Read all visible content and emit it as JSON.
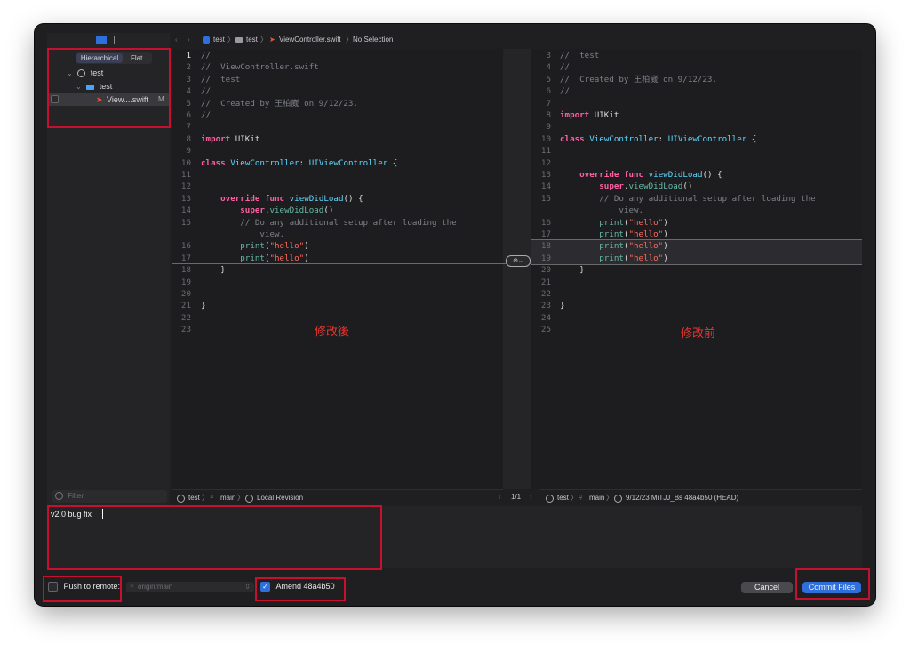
{
  "sidebar": {
    "segments": [
      "Hierarchical",
      "Flat"
    ],
    "tree": [
      {
        "label": "test",
        "icon": "clock-icon"
      },
      {
        "label": "test",
        "icon": "folder-icon"
      },
      {
        "label": "View....swift",
        "icon": "swift-icon",
        "badge": "M"
      }
    ],
    "filter_placeholder": "Filter"
  },
  "breadcrumb": {
    "project": "test",
    "folder": "test",
    "file": "ViewController.swift",
    "selection": "No Selection"
  },
  "left_pane": {
    "annotation": "修改後",
    "lines": [
      {
        "n": "1",
        "t": [
          [
            "c-com",
            "//"
          ]
        ]
      },
      {
        "n": "2",
        "t": [
          [
            "c-com",
            "//  ViewController.swift"
          ]
        ]
      },
      {
        "n": "3",
        "t": [
          [
            "c-com",
            "//  test"
          ]
        ]
      },
      {
        "n": "4",
        "t": [
          [
            "c-com",
            "//"
          ]
        ]
      },
      {
        "n": "5",
        "t": [
          [
            "c-com",
            "//  Created by 王柏崴 on 9/12/23."
          ]
        ]
      },
      {
        "n": "6",
        "t": [
          [
            "c-com",
            "//"
          ]
        ]
      },
      {
        "n": "7",
        "t": []
      },
      {
        "n": "8",
        "t": [
          [
            "c-kw",
            "import"
          ],
          [
            "c-pl",
            " UIKit"
          ]
        ]
      },
      {
        "n": "9",
        "t": []
      },
      {
        "n": "10",
        "t": [
          [
            "c-kw",
            "class"
          ],
          [
            "c-pl",
            " "
          ],
          [
            "c-ty",
            "ViewController"
          ],
          [
            "c-pl",
            ": "
          ],
          [
            "c-ty",
            "UIViewController"
          ],
          [
            "c-pl",
            " {"
          ]
        ]
      },
      {
        "n": "11",
        "t": []
      },
      {
        "n": "12",
        "t": []
      },
      {
        "n": "13",
        "t": [
          [
            "c-pl",
            "    "
          ],
          [
            "c-kw",
            "override"
          ],
          [
            "c-pl",
            " "
          ],
          [
            "c-kw",
            "func"
          ],
          [
            "c-pl",
            " "
          ],
          [
            "c-ty",
            "viewDidLoad"
          ],
          [
            "c-pl",
            "() {"
          ]
        ]
      },
      {
        "n": "14",
        "t": [
          [
            "c-pl",
            "        "
          ],
          [
            "c-kw",
            "super"
          ],
          [
            "c-pl",
            "."
          ],
          [
            "c-fn",
            "viewDidLoad"
          ],
          [
            "c-pl",
            "()"
          ]
        ]
      },
      {
        "n": "15",
        "t": [
          [
            "c-pl",
            "        "
          ],
          [
            "c-com",
            "// Do any additional setup after loading the"
          ]
        ]
      },
      {
        "n": "",
        "t": [
          [
            "c-pl",
            "            "
          ],
          [
            "c-com",
            "view."
          ]
        ]
      },
      {
        "n": "16",
        "t": [
          [
            "c-pl",
            "        "
          ],
          [
            "c-fn",
            "print"
          ],
          [
            "c-pl",
            "("
          ],
          [
            "c-str",
            "\"hello\""
          ],
          [
            "c-pl",
            ")"
          ]
        ]
      },
      {
        "n": "17",
        "t": [
          [
            "c-pl",
            "        "
          ],
          [
            "c-fn",
            "print"
          ],
          [
            "c-pl",
            "("
          ],
          [
            "c-str",
            "\"hello\""
          ],
          [
            "c-pl",
            ")"
          ]
        ]
      },
      {
        "n": "18",
        "t": [
          [
            "c-pl",
            "    }"
          ]
        ]
      },
      {
        "n": "19",
        "t": []
      },
      {
        "n": "20",
        "t": []
      },
      {
        "n": "21",
        "t": [
          [
            "c-pl",
            "}"
          ]
        ]
      },
      {
        "n": "22",
        "t": []
      },
      {
        "n": "23",
        "t": []
      }
    ]
  },
  "right_pane": {
    "annotation": "修改前",
    "lines": [
      {
        "n": "3",
        "t": [
          [
            "c-com",
            "//  test"
          ]
        ]
      },
      {
        "n": "4",
        "t": [
          [
            "c-com",
            "//"
          ]
        ]
      },
      {
        "n": "5",
        "t": [
          [
            "c-com",
            "//  Created by 王柏崴 on 9/12/23."
          ]
        ]
      },
      {
        "n": "6",
        "t": [
          [
            "c-com",
            "//"
          ]
        ]
      },
      {
        "n": "7",
        "t": []
      },
      {
        "n": "8",
        "t": [
          [
            "c-kw",
            "import"
          ],
          [
            "c-pl",
            " UIKit"
          ]
        ]
      },
      {
        "n": "9",
        "t": []
      },
      {
        "n": "10",
        "t": [
          [
            "c-kw",
            "class"
          ],
          [
            "c-pl",
            " "
          ],
          [
            "c-ty",
            "ViewController"
          ],
          [
            "c-pl",
            ": "
          ],
          [
            "c-ty",
            "UIViewController"
          ],
          [
            "c-pl",
            " {"
          ]
        ]
      },
      {
        "n": "11",
        "t": []
      },
      {
        "n": "12",
        "t": []
      },
      {
        "n": "13",
        "t": [
          [
            "c-pl",
            "    "
          ],
          [
            "c-kw",
            "override"
          ],
          [
            "c-pl",
            " "
          ],
          [
            "c-kw",
            "func"
          ],
          [
            "c-pl",
            " "
          ],
          [
            "c-ty",
            "viewDidLoad"
          ],
          [
            "c-pl",
            "() {"
          ]
        ]
      },
      {
        "n": "14",
        "t": [
          [
            "c-pl",
            "        "
          ],
          [
            "c-kw",
            "super"
          ],
          [
            "c-pl",
            "."
          ],
          [
            "c-fn",
            "viewDidLoad"
          ],
          [
            "c-pl",
            "()"
          ]
        ]
      },
      {
        "n": "15",
        "t": [
          [
            "c-pl",
            "        "
          ],
          [
            "c-com",
            "// Do any additional setup after loading the"
          ]
        ]
      },
      {
        "n": "",
        "t": [
          [
            "c-pl",
            "            "
          ],
          [
            "c-com",
            "view."
          ]
        ]
      },
      {
        "n": "16",
        "t": [
          [
            "c-pl",
            "        "
          ],
          [
            "c-fn",
            "print"
          ],
          [
            "c-pl",
            "("
          ],
          [
            "c-str",
            "\"hello\""
          ],
          [
            "c-pl",
            ")"
          ]
        ]
      },
      {
        "n": "17",
        "t": [
          [
            "c-pl",
            "        "
          ],
          [
            "c-fn",
            "print"
          ],
          [
            "c-pl",
            "("
          ],
          [
            "c-str",
            "\"hello\""
          ],
          [
            "c-pl",
            ")"
          ]
        ]
      },
      {
        "n": "18",
        "t": [
          [
            "c-pl",
            "        "
          ],
          [
            "c-fn",
            "print"
          ],
          [
            "c-pl",
            "("
          ],
          [
            "c-str",
            "\"hello\""
          ],
          [
            "c-pl",
            ")"
          ]
        ]
      },
      {
        "n": "19",
        "t": [
          [
            "c-pl",
            "        "
          ],
          [
            "c-fn",
            "print"
          ],
          [
            "c-pl",
            "("
          ],
          [
            "c-str",
            "\"hello\""
          ],
          [
            "c-pl",
            ")"
          ]
        ]
      },
      {
        "n": "20",
        "t": [
          [
            "c-pl",
            "    }"
          ]
        ]
      },
      {
        "n": "21",
        "t": []
      },
      {
        "n": "22",
        "t": []
      },
      {
        "n": "23",
        "t": [
          [
            "c-pl",
            "}"
          ]
        ]
      },
      {
        "n": "24",
        "t": []
      },
      {
        "n": "25",
        "t": []
      }
    ]
  },
  "left_footer": {
    "project": "test",
    "branch": "main",
    "revision": "Local Revision"
  },
  "change_counter": "1/1",
  "right_footer": {
    "project": "test",
    "branch": "main",
    "revision": "9/12/23  MiTJJ_Bs  48a4b50 (HEAD)"
  },
  "commit_message": "v2.0 bug fix",
  "push": {
    "label": "Push to remote:",
    "checked": false,
    "remote": "origin/main"
  },
  "amend": {
    "label": "Amend 48a4b50",
    "checked": true
  },
  "buttons": {
    "cancel": "Cancel",
    "commit": "Commit Files"
  },
  "colors": {
    "accent": "#2f6fdb",
    "highlight": "#c8102e"
  }
}
